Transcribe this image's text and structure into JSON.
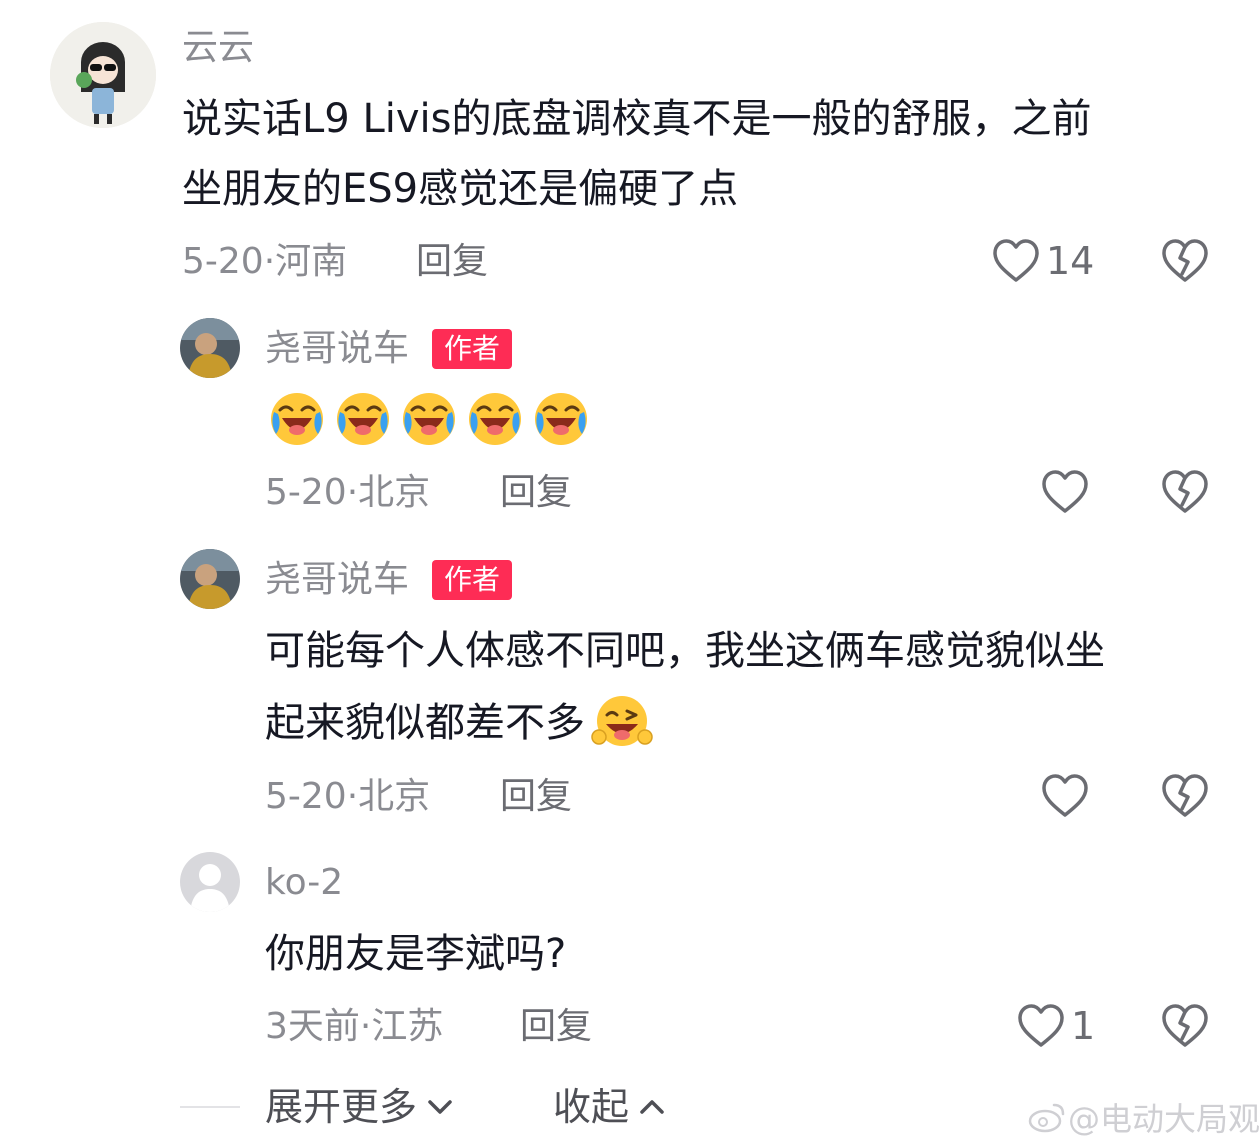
{
  "comments": [
    {
      "username": "云云",
      "text_lines": [
        "说实话L9 Livis的底盘调校真不是一般的舒服，之前",
        "坐朋友的ES9感觉还是偏硬了点"
      ],
      "meta": "5-20·河南",
      "reply_label": "回复",
      "likes": "14"
    },
    {
      "username": "尧哥说车",
      "badge": "作者",
      "emoji_count": 5,
      "meta": "5-20·北京",
      "reply_label": "回复",
      "likes": ""
    },
    {
      "username": "尧哥说车",
      "badge": "作者",
      "text_lines": [
        "可能每个人体感不同吧，我坐这俩车感觉貌似坐",
        "起来貌似都差不多"
      ],
      "meta": "5-20·北京",
      "reply_label": "回复",
      "likes": ""
    },
    {
      "username": "ko-2",
      "text_lines": [
        "你朋友是李斌吗?"
      ],
      "meta": "3天前·江苏",
      "reply_label": "回复",
      "likes": "1"
    }
  ],
  "footer": {
    "expand_label": "展开更多",
    "collapse_label": "收起"
  },
  "watermark": "@电动大局观",
  "colors": {
    "badge": "#fe2c55",
    "secondary_text": "#8a8b91",
    "primary_text": "#161823"
  },
  "icons": {
    "like": "heart-outline-icon",
    "dislike": "broken-heart-icon",
    "emoji_laugh_cry": "laughing-crying-emoji-icon",
    "emoji_wink": "wink-tongue-emoji-icon"
  }
}
